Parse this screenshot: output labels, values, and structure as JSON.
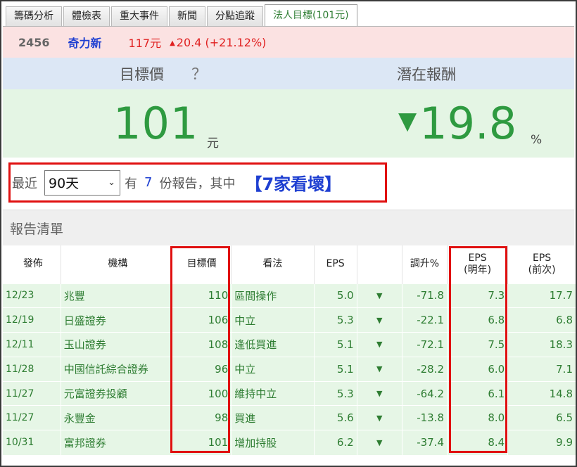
{
  "tabs": [
    {
      "label": "籌碼分析",
      "active": false
    },
    {
      "label": "體檢表",
      "active": false
    },
    {
      "label": "重大事件",
      "active": false
    },
    {
      "label": "新聞",
      "active": false
    },
    {
      "label": "分點追蹤",
      "active": false
    },
    {
      "label": "法人目標(101元)",
      "active": true
    }
  ],
  "stock": {
    "code": "2456",
    "name": "奇力新",
    "price": "117元",
    "change_arrow": "▲",
    "change": "20.4 (+21.12%)"
  },
  "summary": {
    "target_label": "目標價",
    "help": "？",
    "return_label": "潛在報酬",
    "target_value": "101",
    "target_unit": "元",
    "return_arrow": "▼",
    "return_value": "19.8",
    "return_unit": "%"
  },
  "filter": {
    "recent_label": "最近",
    "period": "90天",
    "have_label": "有",
    "report_count": "7",
    "rest_label": "份報告，其中",
    "outlook_summary": "【7家看壞】"
  },
  "list_title": "報告清單",
  "table": {
    "headers": {
      "date": "發佈",
      "org": "機構",
      "target": "目標價",
      "view": "看法",
      "eps": "EPS",
      "chg": "調升%",
      "eps_next_1": "EPS",
      "eps_next_2": "(明年)",
      "eps_prev_1": "EPS",
      "eps_prev_2": "(前次)"
    },
    "rows": [
      {
        "date": "12/23",
        "org": "兆豐",
        "target": "110",
        "view": "區間操作",
        "eps": "5.0",
        "arrow": "▼",
        "chg": "-71.8",
        "eps_next": "7.3",
        "eps_prev": "17.7"
      },
      {
        "date": "12/19",
        "org": "日盛證券",
        "target": "106",
        "view": "中立",
        "eps": "5.3",
        "arrow": "▼",
        "chg": "-22.1",
        "eps_next": "6.8",
        "eps_prev": "6.8"
      },
      {
        "date": "12/11",
        "org": "玉山證券",
        "target": "108",
        "view": "逢低買進",
        "eps": "5.1",
        "arrow": "▼",
        "chg": "-72.1",
        "eps_next": "7.5",
        "eps_prev": "18.3"
      },
      {
        "date": "11/28",
        "org": "中國信託綜合證券",
        "target": "96",
        "view": "中立",
        "eps": "5.1",
        "arrow": "▼",
        "chg": "-28.2",
        "eps_next": "6.0",
        "eps_prev": "7.1"
      },
      {
        "date": "11/27",
        "org": "元富證券投顧",
        "target": "100",
        "view": "維持中立",
        "eps": "5.3",
        "arrow": "▼",
        "chg": "-64.2",
        "eps_next": "6.1",
        "eps_prev": "14.8"
      },
      {
        "date": "11/27",
        "org": "永豐金",
        "target": "98",
        "view": "買進",
        "eps": "5.6",
        "arrow": "▼",
        "chg": "-13.8",
        "eps_next": "8.0",
        "eps_prev": "6.5"
      },
      {
        "date": "10/31",
        "org": "富邦證券",
        "target": "101",
        "view": "增加持股",
        "eps": "6.2",
        "arrow": "▼",
        "chg": "-37.4",
        "eps_next": "8.4",
        "eps_prev": "9.9"
      }
    ]
  },
  "colors": {
    "accent_green": "#2e9a40",
    "highlight_red": "#e01010",
    "link_blue": "#1e3fd1",
    "up_red": "#e02020"
  }
}
